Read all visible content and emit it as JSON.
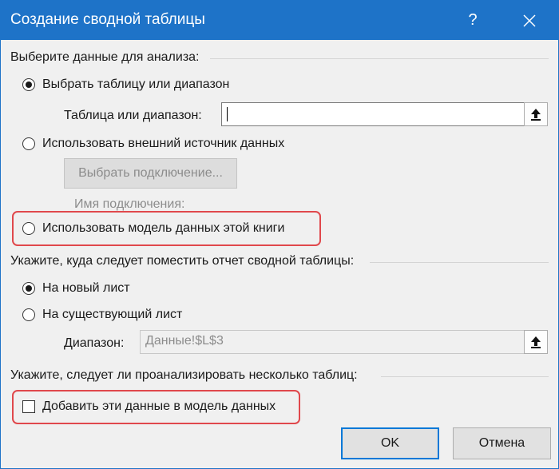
{
  "dialog": {
    "title": "Создание сводной таблицы",
    "help_label": "?"
  },
  "data_source": {
    "heading": "Выберите данные для анализа:",
    "option_table_range": "Выбрать таблицу или диапазон",
    "option_table_range_selected": true,
    "table_range_label": "Таблица или диапазон:",
    "table_range_value": "",
    "option_external": "Использовать внешний источник данных",
    "choose_connection_button": "Выбрать подключение...",
    "connection_name_label": "Имя подключения:",
    "option_data_model": "Использовать модель данных этой книги"
  },
  "placement": {
    "heading": "Укажите, куда следует поместить отчет сводной таблицы:",
    "option_new_sheet": "На новый лист",
    "option_new_sheet_selected": true,
    "option_existing_sheet": "На существующий лист",
    "range_label": "Диапазон:",
    "range_value": "Данные!$L$3"
  },
  "multiple_tables": {
    "heading": "Укажите, следует ли проанализировать несколько таблиц:",
    "add_to_model_label": "Добавить эти данные в модель данных",
    "add_to_model_checked": false
  },
  "footer": {
    "ok_label": "OK",
    "cancel_label": "Отмена"
  },
  "colors": {
    "titlebar": "#1e73c8",
    "highlight": "#e0484c",
    "default_button_border": "#0078d7"
  }
}
